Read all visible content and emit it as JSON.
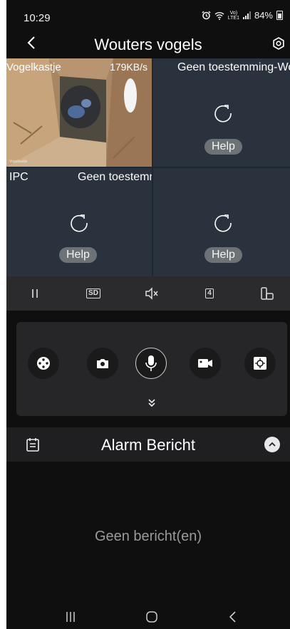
{
  "status_bar": {
    "time": "10:29",
    "network_top": "Vo)",
    "network_bottom": "LTE1",
    "battery": "84%"
  },
  "header": {
    "title": "Wouters vogels",
    "back_icon": "back-arrow-icon",
    "settings_icon": "gear-icon"
  },
  "cameras": [
    {
      "name": "Vogelkastje",
      "rate": "179KB/s",
      "watermark": "Vogelkastje"
    },
    {
      "label": "Geen toestemming-Wouters vogels",
      "help": "Help"
    },
    {
      "label": "IPC",
      "label2": "Geen toestemming-Wouters vogels",
      "help": "Help"
    },
    {
      "help": "Help"
    }
  ],
  "toolbar": {
    "sd_label": "SD",
    "split_label": "4",
    "icons": [
      "pause-icon",
      "sd-quality-icon",
      "mute-icon",
      "split-4-icon",
      "device-rotate-icon"
    ]
  },
  "controls": [
    "ptz-control-icon",
    "snapshot-icon",
    "microphone-icon",
    "record-icon",
    "focus-capture-icon",
    "expand-down-icon"
  ],
  "alarm": {
    "title": "Alarm Bericht",
    "empty_text": "Geen bericht(en)"
  },
  "colors": {
    "background": "#0f0f10",
    "tile": "#29323d",
    "help_pill": "#6d7277",
    "toolbar": "#2b2b2d"
  }
}
